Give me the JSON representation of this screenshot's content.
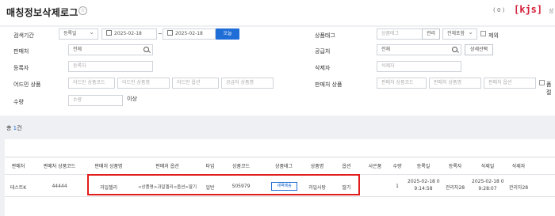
{
  "page": {
    "title": "매칭정보삭제로그",
    "count_text": "( 0 )",
    "brand": "[kjs]",
    "brand_ext": "상"
  },
  "filters": {
    "period_label": "검색기간",
    "period_type": "등록일",
    "date_from": "2025-02-18",
    "date_to": "2025-02-18",
    "today_button": "오늘",
    "seller_label": "판매처",
    "seller_value": "전체",
    "registrant_label": "등록자",
    "registrant_placeholder": "등록자",
    "admin_product_label": "어드민 상품",
    "admin_product_code_ph": "어드민 상품코드",
    "admin_product_name_ph": "어드민 상품명",
    "admin_option_ph": "어드민 옵션",
    "supplier_product_name_ph": "공급처 상품명",
    "quantity_label": "수량",
    "quantity_placeholder": "수량",
    "quantity_suffix": "이상",
    "product_tag_label": "상품태그",
    "product_tag_ph": "상품태그",
    "manage_button": "관리",
    "tag_scope": "전체포함",
    "except_label": "제외",
    "supplier_label": "공급처",
    "supplier_value": "전체",
    "multi_select_button": "상세선택",
    "deleter_label": "삭제자",
    "deleter_placeholder": "삭제자",
    "seller_product_label": "판매처 상품",
    "seller_product_code_ph": "판매처 상품코드",
    "seller_product_name_ph": "판매처 상품명",
    "seller_option_ph": "판매처 옵션",
    "exact_label": "품절"
  },
  "summary": {
    "prefix": "총 ",
    "count": "1",
    "suffix": "건"
  },
  "table": {
    "headers": [
      "판매처",
      "판매처 상품코드",
      "판매처 상품명",
      "판매처 옵션",
      "타입",
      "상품코드",
      "상품태그",
      "상품명",
      "옵션",
      "사은품",
      "수량",
      "등록일",
      "등록자",
      "삭제일",
      "삭제자"
    ],
    "row": {
      "seller": "테스트K",
      "seller_code": "44444",
      "seller_product": "과일젤리",
      "seller_option": "<상품명>과일젤리<옵션>딸기",
      "type": "일반",
      "product_code": "S05979",
      "tag": "새벽배송",
      "product_name": "과일사탕",
      "option": "딸기",
      "gift": "",
      "qty": "1",
      "reg_date_1": "2025-02-18 0",
      "reg_date_2": "9:14:58",
      "registrant": "관리자28",
      "del_date_1": "2025-02-18 0",
      "del_date_2": "9:28:07",
      "deleter": "관리자28"
    }
  },
  "colors": {
    "accent": "#1f6dd6",
    "brand": "#d3203b",
    "highlight": "#e21b1b"
  }
}
